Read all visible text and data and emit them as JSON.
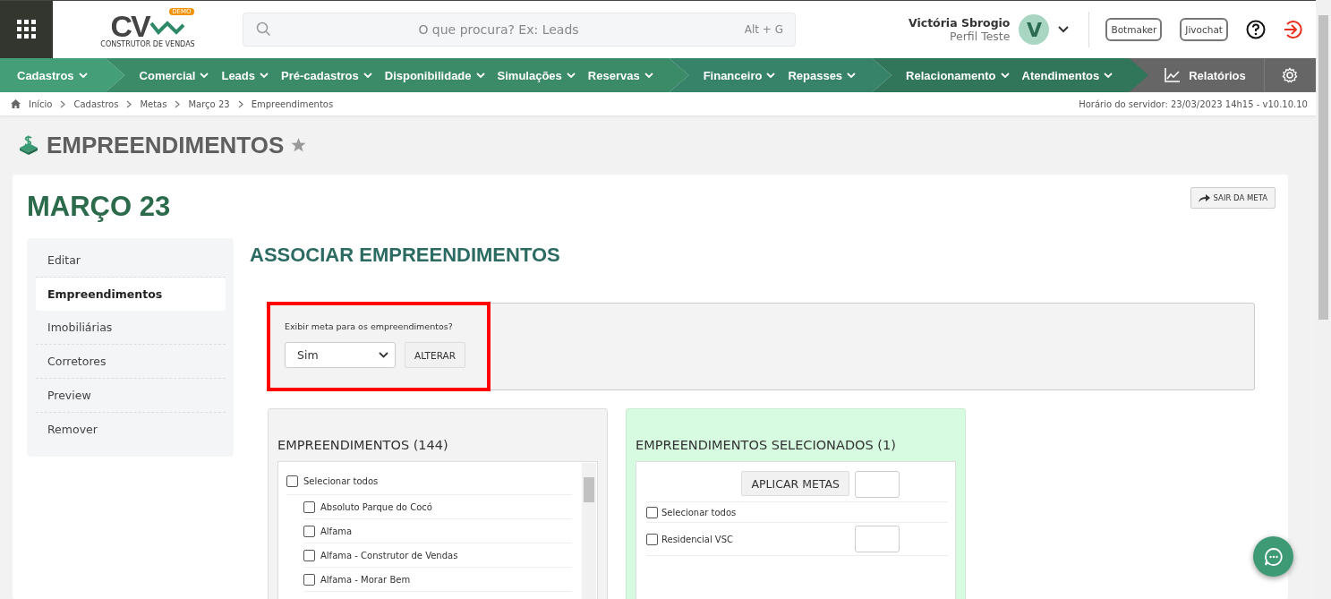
{
  "header": {
    "logo_text": "CV",
    "logo_badge": "DEMO",
    "logo_subtitle": "CONSTRUTOR DE VENDAS",
    "search": {
      "placeholder": "O que procura? Ex: Leads",
      "shortcut": "Alt + G"
    },
    "user": {
      "name": "Victória Sbrogio",
      "profile": "Perfil Teste",
      "initial": "V"
    },
    "buttons": [
      "Botmaker",
      "Jivochat"
    ]
  },
  "nav": [
    {
      "items": [
        "Cadastros"
      ]
    },
    {
      "items": [
        "Comercial",
        "Leads",
        "Pré-cadastros",
        "Disponibilidade",
        "Simulações",
        "Reservas"
      ]
    },
    {
      "items": [
        "Financeiro",
        "Repasses"
      ]
    },
    {
      "items": [
        "Relacionamento",
        "Atendimentos"
      ]
    }
  ],
  "reports": "Relatórios",
  "breadcrumb": [
    "Início",
    "Cadastros",
    "Metas",
    "Março 23",
    "Empreendimentos"
  ],
  "server_time": "Horário do servidor: 23/03/2023 14h15 - v10.10.10",
  "page_title": "EMPREENDIMENTOS",
  "card": {
    "title": "MARÇO 23",
    "exit_button": "SAIR DA META"
  },
  "side_menu": [
    {
      "label": "Editar",
      "selected": false
    },
    {
      "label": "Empreendimentos",
      "selected": true
    },
    {
      "label": "Imobiliárias",
      "selected": false
    },
    {
      "label": "Corretores",
      "selected": false
    },
    {
      "label": "Preview",
      "selected": false
    },
    {
      "label": "Remover",
      "selected": false
    }
  ],
  "section_title": "ASSOCIAR EMPREENDIMENTOS",
  "form": {
    "highlighted": true,
    "label": "Exibir meta para os empreendimentos?",
    "value": "Sim",
    "button": "ALTERAR"
  },
  "available": {
    "title": "EMPREENDIMENTOS (144)",
    "select_all": {
      "label": "Selecionar todos",
      "checked": false
    },
    "items": [
      {
        "label": "Absoluto Parque do Cocó",
        "checked": false
      },
      {
        "label": "Alfama",
        "checked": false
      },
      {
        "label": "Alfama - Construtor de Vendas",
        "checked": false
      },
      {
        "label": "Alfama - Morar Bem",
        "checked": false
      }
    ]
  },
  "selected_list": {
    "title": "EMPREENDIMENTOS SELECIONADOS (1)",
    "apply_button": "APLICAR METAS",
    "select_all": {
      "label": "Selecionar todos",
      "checked": false
    },
    "items": [
      {
        "label": "Residencial VSC",
        "checked": false
      }
    ]
  }
}
